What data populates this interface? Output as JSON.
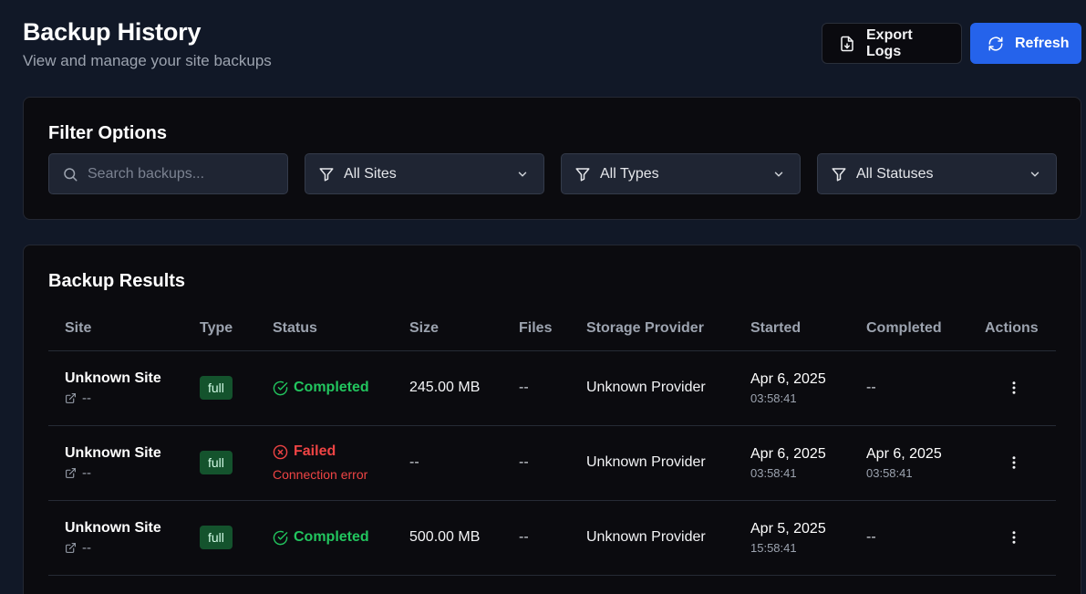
{
  "header": {
    "title": "Backup History",
    "subtitle": "View and manage your site backups",
    "export_label": "Export Logs",
    "refresh_label": "Refresh"
  },
  "filters": {
    "title": "Filter Options",
    "search_placeholder": "Search backups...",
    "site_select": "All Sites",
    "type_select": "All Types",
    "status_select": "All Statuses"
  },
  "results": {
    "title": "Backup Results",
    "columns": [
      "Site",
      "Type",
      "Status",
      "Size",
      "Files",
      "Storage Provider",
      "Started",
      "Completed",
      "Actions"
    ],
    "rows": [
      {
        "site": "Unknown Site",
        "site_link": "--",
        "type": "full",
        "status": "Completed",
        "status_kind": "ok",
        "error": "",
        "size": "245.00 MB",
        "files": "--",
        "provider": "Unknown Provider",
        "started_date": "Apr 6, 2025",
        "started_time": "03:58:41",
        "completed_date": "--",
        "completed_time": ""
      },
      {
        "site": "Unknown Site",
        "site_link": "--",
        "type": "full",
        "status": "Failed",
        "status_kind": "fail",
        "error": "Connection error",
        "size": "--",
        "files": "--",
        "provider": "Unknown Provider",
        "started_date": "Apr 6, 2025",
        "started_time": "03:58:41",
        "completed_date": "Apr 6, 2025",
        "completed_time": "03:58:41"
      },
      {
        "site": "Unknown Site",
        "site_link": "--",
        "type": "full",
        "status": "Completed",
        "status_kind": "ok",
        "error": "",
        "size": "500.00 MB",
        "files": "--",
        "provider": "Unknown Provider",
        "started_date": "Apr 5, 2025",
        "started_time": "15:58:41",
        "completed_date": "--",
        "completed_time": ""
      }
    ]
  },
  "colors": {
    "background": "#111827",
    "card": "#0b0b0f",
    "accent": "#2563eb",
    "success": "#22c55e",
    "danger": "#ef4444",
    "badge": "#14532d"
  },
  "icons": {
    "export": "file-download-icon",
    "refresh": "refresh-icon",
    "search": "search-icon",
    "filter": "filter-icon",
    "chevron": "chevron-down-icon",
    "external_link": "external-link-icon",
    "completed": "check-circle-icon",
    "failed": "x-circle-icon",
    "actions": "more-vertical-icon"
  }
}
